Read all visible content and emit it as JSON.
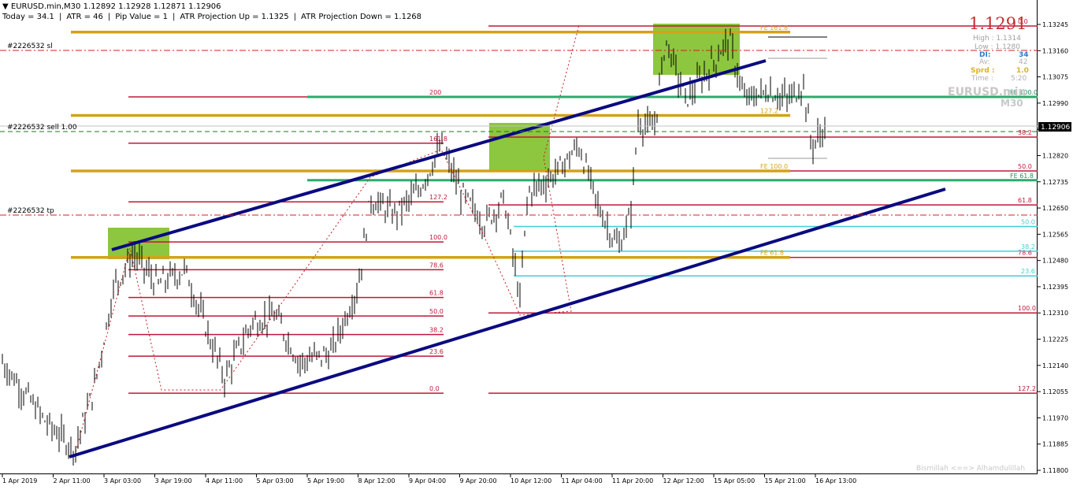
{
  "header": {
    "symbol_line": "EURUSD.min,M30  1.12892 1.12928 1.12871 1.12906",
    "today": "Today = 34.1",
    "atr": "ATR = 46",
    "pip_value": "Pip Value = 1",
    "atr_up": "ATR Projection Up = 1.1325",
    "atr_down": "ATR Projection Down = 1.1268"
  },
  "order_labels": {
    "sl": "#2226532 sl",
    "sell": "#2226532 sell 1.00",
    "tp": "#2226532 tp"
  },
  "info_panel": {
    "big_price": "1.1291",
    "high": "High : 1.1314",
    "low": "Low : 1.1280",
    "di_label": "DI:",
    "di_value": "34",
    "av_label": "Av:",
    "av_value": "42",
    "sprd_label": "Sprd :",
    "sprd_value": "1.0",
    "time_label": "Time :",
    "time_value": "5:20",
    "symbol_wm": "EURUSD.min",
    "tf_wm": "M30"
  },
  "footer_text": "Bismillah <==> Alhamdulillah",
  "current_price_label": "1.12906",
  "colors": {
    "candle": "#000000",
    "channel": "#0a0a80",
    "fib_red": "#c0183a",
    "gold": "#d4a21a",
    "green_line": "#2eaa6e",
    "cyan": "#40d0d0",
    "box_green": "#8dc63f",
    "order_red": "#d02020"
  },
  "chart_data": {
    "type": "candlestick",
    "symbol": "EURUSD.min",
    "timeframe": "M30",
    "ohlc_current": {
      "open": 1.12892,
      "high": 1.12928,
      "low": 1.12871,
      "close": 1.12906
    },
    "y_ticks": [
      "1.13245",
      "1.13160",
      "1.13075",
      "1.12990",
      "1.12906",
      "1.12820",
      "1.12735",
      "1.12650",
      "1.12565",
      "1.12480",
      "1.12395",
      "1.12310",
      "1.12225",
      "1.12140",
      "1.12055",
      "1.11970",
      "1.11885",
      "1.11800"
    ],
    "ylim": [
      1.118,
      1.13245
    ],
    "x_ticks": [
      "1 Apr 2019",
      "2 Apr 11:00",
      "3 Apr 03:00",
      "3 Apr 19:00",
      "4 Apr 11:00",
      "5 Apr 03:00",
      "5 Apr 19:00",
      "8 Apr 12:00",
      "9 Apr 04:00",
      "9 Apr 20:00",
      "10 Apr 12:00",
      "11 Apr 04:00",
      "11 Apr 20:00",
      "12 Apr 12:00",
      "15 Apr 05:00",
      "15 Apr 21:00",
      "16 Apr 13:00"
    ],
    "fib_left": [
      {
        "label": "200",
        "price": 1.1301
      },
      {
        "label": "161.8",
        "price": 1.1286
      },
      {
        "label": "127.2",
        "price": 1.1267
      },
      {
        "label": "100.0",
        "price": 1.1254
      },
      {
        "label": "78.6",
        "price": 1.1245
      },
      {
        "label": "61.8",
        "price": 1.1236
      },
      {
        "label": "50.0",
        "price": 1.123
      },
      {
        "label": "38.2",
        "price": 1.1224
      },
      {
        "label": "23.6",
        "price": 1.1217
      },
      {
        "label": "0.0",
        "price": 1.1205
      }
    ],
    "fib_right": [
      {
        "label": "0.0",
        "price": 1.1324
      },
      {
        "label": "38.2",
        "price": 1.1288
      },
      {
        "label": "50.0",
        "price": 1.1277
      },
      {
        "label": "61.8",
        "price": 1.1266
      },
      {
        "label": "78.6",
        "price": 1.1249
      },
      {
        "label": "100.0",
        "price": 1.1231
      },
      {
        "label": "127.2",
        "price": 1.1205
      }
    ],
    "cyan_levels": [
      {
        "label": "50.0",
        "price": 1.1259
      },
      {
        "label": "38.2",
        "price": 1.1251
      },
      {
        "label": "23.6",
        "price": 1.1243
      }
    ],
    "gold_levels": [
      {
        "label": "FE 161.8",
        "price": 1.1322
      },
      {
        "label": "127.2",
        "price": 1.1295
      },
      {
        "label": "FE 100.0",
        "price": 1.1277
      },
      {
        "label": "FE 61.8",
        "price": 1.1249
      }
    ],
    "green_levels": [
      {
        "label": "FE 100.0",
        "price": 1.1301
      },
      {
        "label": "FE 61.8",
        "price": 1.1274
      }
    ],
    "order_levels": {
      "sl": 1.13165,
      "sell": 1.12887,
      "tp": 1.12625
    }
  }
}
